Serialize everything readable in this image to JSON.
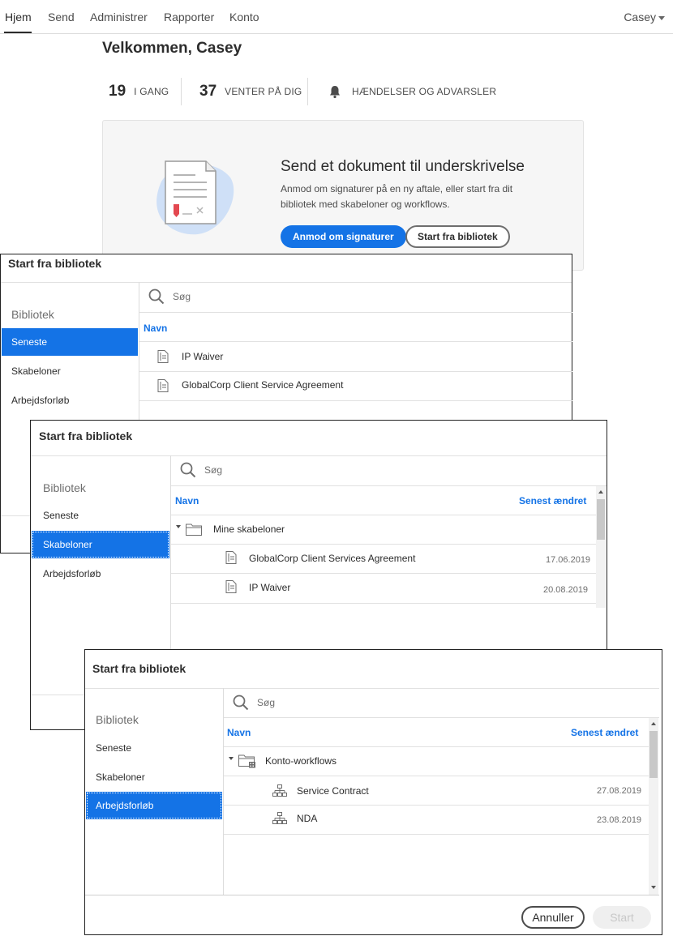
{
  "nav": {
    "tabs": [
      "Hjem",
      "Send",
      "Administrer",
      "Rapporter",
      "Konto"
    ],
    "user": "Casey"
  },
  "welcome": "Velkommen, Casey",
  "stats": [
    {
      "num": "19",
      "label": "I GANG"
    },
    {
      "num": "37",
      "label": "VENTER PÅ DIG"
    },
    {
      "num": "",
      "label": "HÆNDELSER OG ADVARSLER"
    }
  ],
  "send_card": {
    "title": "Send et dokument til underskrivelse",
    "desc": "Anmod om signaturer på en ny aftale, eller start fra dit bibliotek med skabeloner og workflows.",
    "primary": "Anmod om signaturer",
    "secondary": "Start fra bibliotek"
  },
  "dialog1": {
    "title": "Start fra bibliotek",
    "category": "Bibliotek",
    "items": [
      "Seneste",
      "Skabeloner",
      "Arbejdsforløb"
    ],
    "search_placeholder": "Søg",
    "col_name": "Navn",
    "rows": [
      "IP Waiver",
      "GlobalCorp Client Service Agreement"
    ]
  },
  "dialog2": {
    "title": "Start fra bibliotek",
    "category": "Bibliotek",
    "items": [
      "Seneste",
      "Skabeloner",
      "Arbejdsforløb"
    ],
    "search_placeholder": "Søg",
    "col_name": "Navn",
    "col_date": "Senest ændret",
    "folder": "Mine skabeloner",
    "rows": [
      {
        "name": "GlobalCorp Client Services Agreement",
        "date": "17.06.2019"
      },
      {
        "name": "IP Waiver",
        "date": "20.08.2019"
      }
    ]
  },
  "dialog3": {
    "title": "Start fra bibliotek",
    "category": "Bibliotek",
    "items": [
      "Seneste",
      "Skabeloner",
      "Arbejdsforløb"
    ],
    "search_placeholder": "Søg",
    "col_name": "Navn",
    "col_date": "Senest ændret",
    "folder": "Konto-workflows",
    "rows": [
      {
        "name": "Service Contract",
        "date": "27.08.2019"
      },
      {
        "name": "NDA",
        "date": "23.08.2019"
      }
    ],
    "cancel": "Annuller",
    "start": "Start"
  },
  "colors": {
    "accent": "#1473e6",
    "text": "#2c2c2c"
  }
}
